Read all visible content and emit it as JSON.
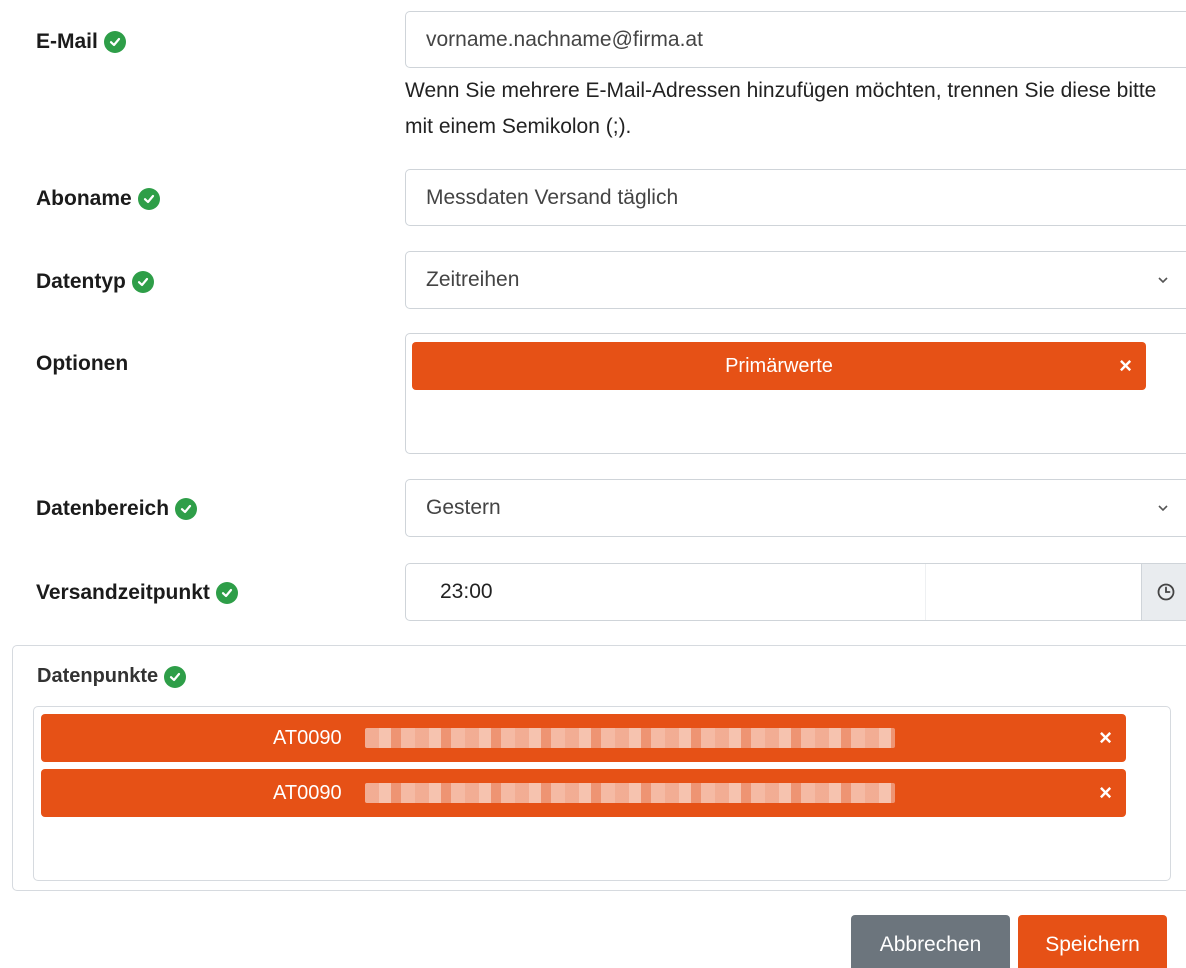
{
  "email": {
    "label": "E-Mail",
    "value": "vorname.nachname@firma.at",
    "help": "Wenn Sie mehrere E-Mail-Adressen hinzufügen möchten, trennen Sie diese bitte mit einem Semikolon (;)."
  },
  "aboname": {
    "label": "Aboname",
    "value": "Messdaten Versand täglich"
  },
  "datentyp": {
    "label": "Datentyp",
    "value": "Zeitreihen"
  },
  "optionen": {
    "label": "Optionen",
    "tags": [
      "Primärwerte"
    ],
    "remove_glyph": "×"
  },
  "datenbereich": {
    "label": "Datenbereich",
    "value": "Gestern"
  },
  "versandzeitpunkt": {
    "label": "Versandzeitpunkt",
    "value": "23:00"
  },
  "datenpunkte": {
    "title": "Datenpunkte",
    "items": [
      {
        "prefix": "AT0090",
        "redacted": true
      },
      {
        "prefix": "AT0090",
        "redacted": true
      }
    ],
    "remove_glyph": "×"
  },
  "buttons": {
    "cancel": "Abbrechen",
    "save": "Speichern"
  },
  "colors": {
    "accent": "#e65116",
    "valid": "#2e9e48",
    "secondary": "#6c757d"
  },
  "icons": {
    "valid": "check-circle-icon",
    "select": "chevron-down-icon",
    "time": "clock-icon",
    "remove": "close-icon"
  }
}
